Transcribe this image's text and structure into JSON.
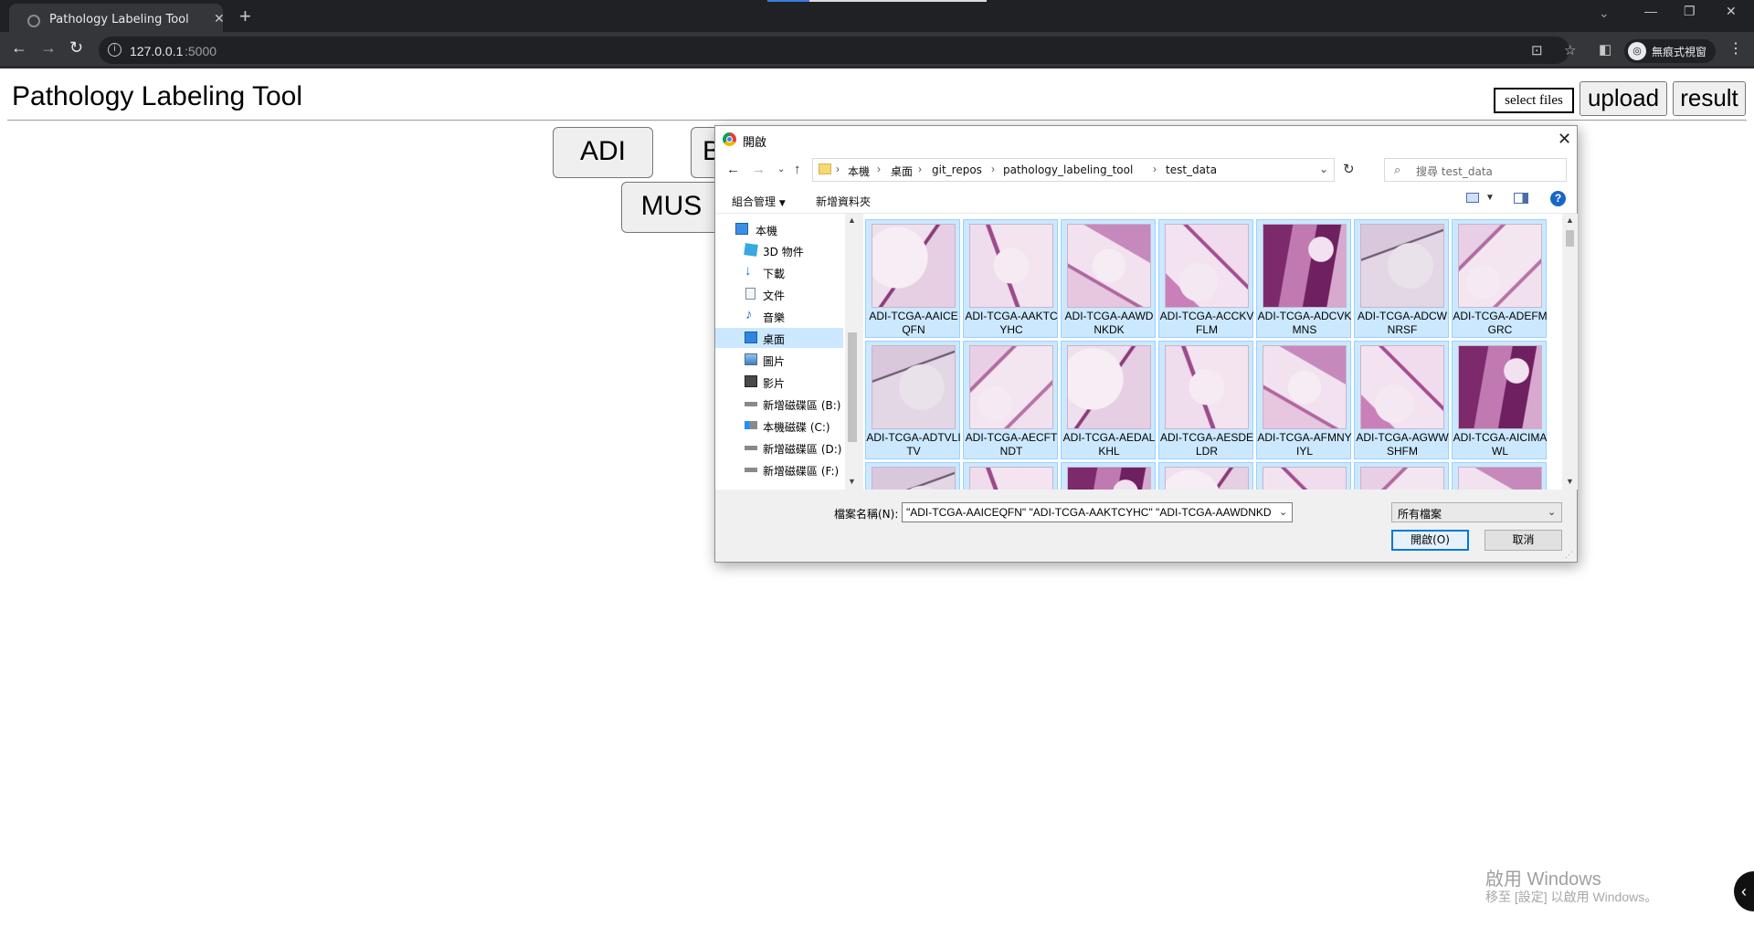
{
  "browser": {
    "tab_title": "Pathology Labeling Tool",
    "url_host": "127.0.0.1",
    "url_port": ":5000",
    "profile_label": "無痕式視窗"
  },
  "page": {
    "title": "Pathology Labeling Tool",
    "select_files_label": "select files",
    "upload_label": "upload",
    "result_label": "result",
    "label_buttons": [
      "ADI",
      "B",
      "MUS"
    ]
  },
  "dialog": {
    "title": "開啟",
    "breadcrumbs": [
      "本機",
      "桌面",
      "git_repos",
      "pathology_labeling_tool",
      "test_data"
    ],
    "search_placeholder": "搜尋 test_data",
    "organize_label": "組合管理",
    "new_folder_label": "新增資料夾",
    "nav_items": [
      {
        "label": "本機",
        "icon": "computer-icon"
      },
      {
        "label": "3D 物件",
        "icon": "cube-icon"
      },
      {
        "label": "下載",
        "icon": "download-arrow-icon"
      },
      {
        "label": "文件",
        "icon": "document-icon"
      },
      {
        "label": "音樂",
        "icon": "music-note-icon"
      },
      {
        "label": "桌面",
        "icon": "desktop-icon"
      },
      {
        "label": "圖片",
        "icon": "picture-icon"
      },
      {
        "label": "影片",
        "icon": "film-icon"
      },
      {
        "label": "新增磁碟區 (B:)",
        "icon": "drive-icon"
      },
      {
        "label": "本機磁碟 (C:)",
        "icon": "windows-drive-icon"
      },
      {
        "label": "新增磁碟區 (D:)",
        "icon": "drive-icon"
      },
      {
        "label": "新增磁碟區 (F:)",
        "icon": "drive-icon"
      }
    ],
    "selected_nav": "桌面",
    "files": [
      "ADI-TCGA-AAICEQFN",
      "ADI-TCGA-AAKTCYHC",
      "ADI-TCGA-AAWDNKDK",
      "ADI-TCGA-ACCKVFLM",
      "ADI-TCGA-ADCVKMNS",
      "ADI-TCGA-ADCWNRSF",
      "ADI-TCGA-ADEFMGRC",
      "ADI-TCGA-ADTVLITV",
      "ADI-TCGA-AECFTNDT",
      "ADI-TCGA-AEDALKHL",
      "ADI-TCGA-AESDELDR",
      "ADI-TCGA-AFMNYIYL",
      "ADI-TCGA-AGWWSHFM",
      "ADI-TCGA-AICIMAWL"
    ],
    "filename_label": "檔案名稱(N):",
    "filename_value": "\"ADI-TCGA-AAICEQFN\" \"ADI-TCGA-AAKTCYHC\" \"ADI-TCGA-AAWDNKDK\" \"ADI-TCGA-AC",
    "filetype_value": "所有檔案",
    "open_label": "開啟(O)",
    "cancel_label": "取消"
  },
  "watermark": {
    "title": "啟用 Windows",
    "subtitle": "移至 [設定] 以啟用 Windows。"
  }
}
